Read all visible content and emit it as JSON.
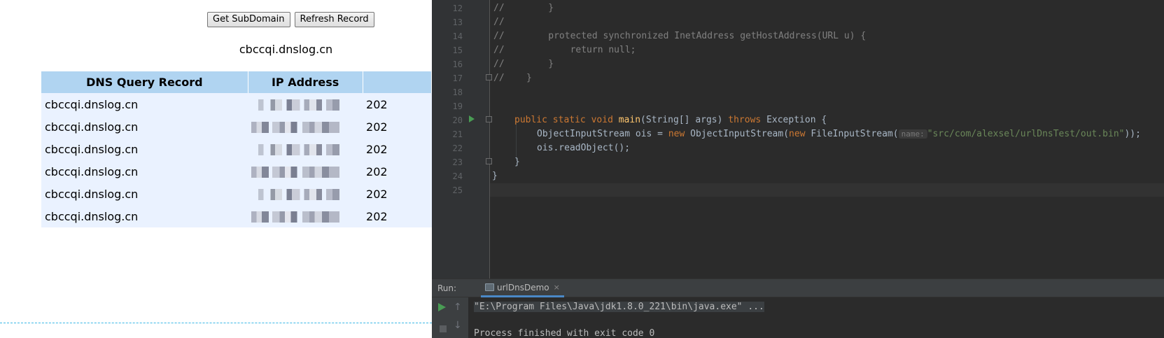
{
  "web": {
    "buttons": {
      "get_subdomain": "Get SubDomain",
      "refresh_record": "Refresh Record"
    },
    "subdomain": "cbccqi.dnslog.cn",
    "table": {
      "headers": [
        "DNS Query Record",
        "IP Address",
        ""
      ],
      "rows": [
        {
          "record": "cbccqi.dnslog.cn",
          "ip": "",
          "time": "202"
        },
        {
          "record": "cbccqi.dnslog.cn",
          "ip": "",
          "time": "202"
        },
        {
          "record": "cbccqi.dnslog.cn",
          "ip": "",
          "time": "202"
        },
        {
          "record": "cbccqi.dnslog.cn",
          "ip": "",
          "time": "202"
        },
        {
          "record": "cbccqi.dnslog.cn",
          "ip": "",
          "time": "202"
        },
        {
          "record": "cbccqi.dnslog.cn",
          "ip": "",
          "time": "202"
        }
      ]
    }
  },
  "editor": {
    "lines": [
      {
        "num": "12",
        "text": "//        }"
      },
      {
        "num": "13",
        "text": "//"
      },
      {
        "num": "14",
        "text": "//        protected synchronized InetAddress getHostAddress(URL u) {"
      },
      {
        "num": "15",
        "text": "//            return null;"
      },
      {
        "num": "16",
        "text": "//        }"
      },
      {
        "num": "17",
        "text": "//    }"
      },
      {
        "num": "18",
        "text": ""
      },
      {
        "num": "19",
        "text": ""
      },
      {
        "num": "20",
        "kw1": "public",
        "kw2": "static",
        "kw3": "void",
        "fn": "main",
        "params": "(String[] args) ",
        "kw4": "throws",
        "tail": " Exception {"
      },
      {
        "num": "21",
        "pre": "ObjectInputStream ois = ",
        "kw": "new",
        "mid": " ObjectInputStream(",
        "kw2": "new",
        "mid2": " FileInputStream(",
        "hint": "name:",
        "str": "\"src/com/alexsel/urlDnsTest/out.bin\"",
        "tail": "));"
      },
      {
        "num": "22",
        "text": "ois.readObject();"
      },
      {
        "num": "23",
        "text": "}"
      },
      {
        "num": "24",
        "text": "}"
      },
      {
        "num": "25",
        "text": ""
      }
    ]
  },
  "run": {
    "label": "Run:",
    "tab": "urlDnsDemo",
    "tab_close": "×",
    "console": {
      "command": "\"E:\\Program Files\\Java\\jdk1.8.0_221\\bin\\java.exe\" ...",
      "exit": "Process finished with exit code 0"
    }
  },
  "colors": {
    "header_bg": "#b0d4f1",
    "row_bg": "#eaf2ff",
    "ide_bg": "#2b2b2b",
    "keyword": "#cc7832",
    "string": "#6a8759"
  }
}
